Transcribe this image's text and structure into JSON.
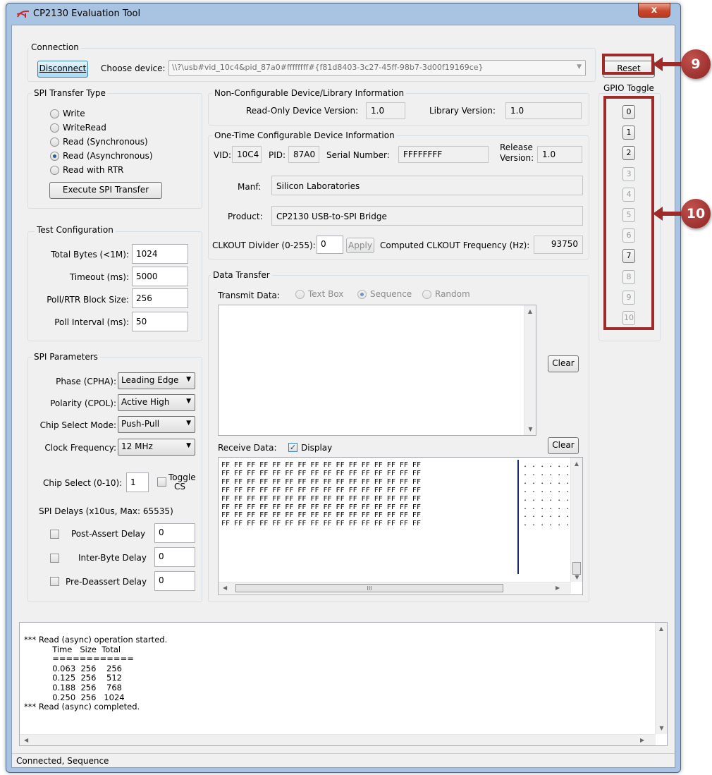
{
  "window": {
    "title": "CP2130 Evaluation Tool",
    "close_label": "x"
  },
  "connection": {
    "group_title": "Connection",
    "disconnect_label": "Disconnect",
    "choose_device_label": "Choose device:",
    "device_value": "\\\\?\\usb#vid_10c4&pid_87a0#ffffffff#{f81d8403-3c27-45ff-98b7-3d00f19169ce}",
    "reset_label": "Reset"
  },
  "spi_transfer_type": {
    "group_title": "SPI Transfer Type",
    "options": [
      "Write",
      "WriteRead",
      "Read (Synchronous)",
      "Read (Asynchronous)",
      "Read with RTR"
    ],
    "selected": "Read (Asynchronous)",
    "execute_label": "Execute SPI Transfer"
  },
  "device_info": {
    "group_title": "Non-Configurable Device/Library Information",
    "readonly_version_label": "Read-Only Device Version:",
    "readonly_version_value": "1.0",
    "library_version_label": "Library Version:",
    "library_version_value": "1.0"
  },
  "otp_info": {
    "group_title": "One-Time Configurable Device Information",
    "vid_label": "VID:",
    "vid_value": "10C4",
    "pid_label": "PID:",
    "pid_value": "87A0",
    "serial_label": "Serial Number:",
    "serial_value": "FFFFFFFF",
    "release_label_1": "Release",
    "release_label_2": "Version:",
    "release_value": "1.0",
    "manf_label": "Manf:",
    "manf_value": "Silicon Laboratories",
    "product_label": "Product:",
    "product_value": "CP2130 USB-to-SPI Bridge",
    "clkout_label": "CLKOUT Divider (0-255):",
    "clkout_value": "0",
    "apply_label": "Apply",
    "computed_label": "Computed CLKOUT Frequency (Hz):",
    "computed_value": "93750"
  },
  "gpio": {
    "group_title": "GPIO Toggle",
    "buttons": [
      {
        "label": "0",
        "enabled": true
      },
      {
        "label": "1",
        "enabled": true
      },
      {
        "label": "2",
        "enabled": true
      },
      {
        "label": "3",
        "enabled": false
      },
      {
        "label": "4",
        "enabled": false
      },
      {
        "label": "5",
        "enabled": false
      },
      {
        "label": "6",
        "enabled": false
      },
      {
        "label": "7",
        "enabled": true
      },
      {
        "label": "8",
        "enabled": false
      },
      {
        "label": "9",
        "enabled": false
      },
      {
        "label": "10",
        "enabled": false
      }
    ]
  },
  "callouts": {
    "reset_badge": "9",
    "gpio_badge": "10",
    "accent_color": "#9e2a2a"
  },
  "test_config": {
    "group_title": "Test Configuration",
    "total_bytes_label": "Total Bytes (<1M):",
    "total_bytes_value": "1024",
    "timeout_label": "Timeout (ms):",
    "timeout_value": "5000",
    "block_size_label": "Poll/RTR Block Size:",
    "block_size_value": "256",
    "poll_interval_label": "Poll Interval (ms):",
    "poll_interval_value": "50"
  },
  "spi_params": {
    "group_title": "SPI Parameters",
    "phase_label": "Phase (CPHA):",
    "phase_value": "Leading Edge",
    "polarity_label": "Polarity (CPOL):",
    "polarity_value": "Active High",
    "cs_mode_label": "Chip Select Mode:",
    "cs_mode_value": "Push-Pull",
    "clock_label": "Clock Frequency:",
    "clock_value": "12 MHz",
    "cs_label": "Chip Select (0-10):",
    "cs_value": "1",
    "toggle_cs_1": "Toggle",
    "toggle_cs_2": "CS",
    "delays_label": "SPI Delays (x10us, Max: 65535)",
    "post_assert_label": "Post-Assert Delay",
    "post_assert_value": "0",
    "inter_byte_label": "Inter-Byte Delay",
    "inter_byte_value": "0",
    "pre_deassert_label": "Pre-Deassert Delay",
    "pre_deassert_value": "0"
  },
  "data_transfer": {
    "group_title": "Data Transfer",
    "transmit_label": "Transmit Data:",
    "transmit_options": [
      "Text Box",
      "Sequence",
      "Random"
    ],
    "transmit_selected": "Sequence",
    "clear_label": "Clear",
    "receive_label": "Receive Data:",
    "display_label": "Display",
    "hex_line": "FF FF FF FF FF FF FF FF FF FF FF FF FF FF FF FF",
    "ascii_line": ". . . . . . .",
    "row_count": 8,
    "hscroll_glyph": "III"
  },
  "log": {
    "lines": [
      "*** Read (async) operation started.",
      "           Time   Size  Total",
      "           ============",
      "           0.063  256    256",
      "           0.125  256    512",
      "           0.188  256    768",
      "           0.250  256   1024",
      "*** Read (async) completed."
    ]
  },
  "status_bar": {
    "text": "Connected, Sequence"
  }
}
